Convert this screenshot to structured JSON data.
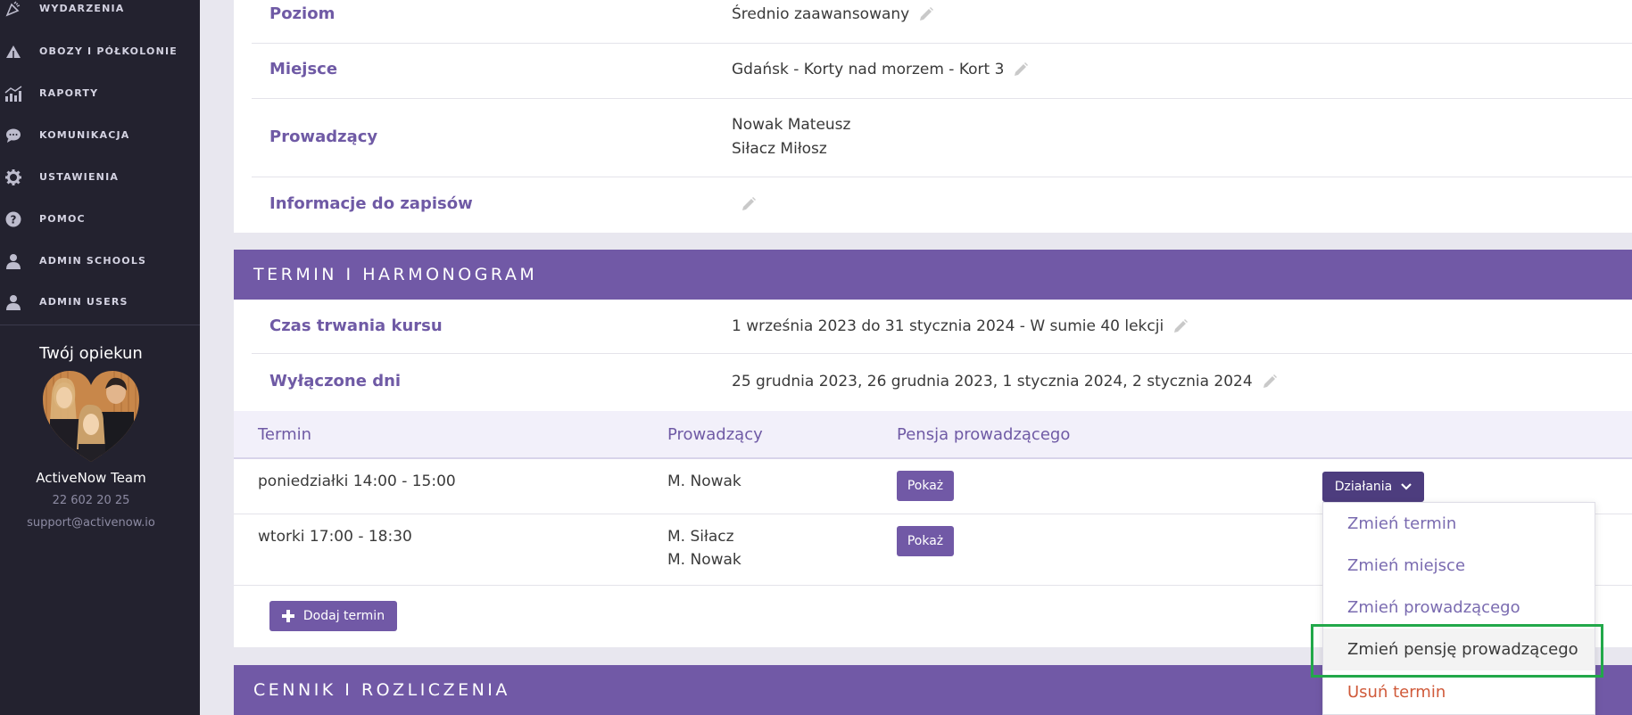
{
  "sidebar": {
    "items": [
      {
        "label": "WYDARZENIA",
        "icon": "party-icon"
      },
      {
        "label": "OBOZY I PÓŁKOLONIE",
        "icon": "tent-icon"
      },
      {
        "label": "RAPORTY",
        "icon": "chart-icon"
      },
      {
        "label": "KOMUNIKACJA",
        "icon": "chat-icon"
      },
      {
        "label": "USTAWIENIA",
        "icon": "gear-icon"
      },
      {
        "label": "POMOC",
        "icon": "help-icon"
      },
      {
        "label": "ADMIN SCHOOLS",
        "icon": "user-icon"
      },
      {
        "label": "ADMIN USERS",
        "icon": "user-icon"
      }
    ],
    "caretaker": {
      "title": "Twój opiekun",
      "name": "ActiveNow Team",
      "phone": "22 602 20 25",
      "email": "support@activenow.io"
    }
  },
  "details": {
    "level": {
      "label": "Poziom",
      "value": "Średnio zaawansowany"
    },
    "place": {
      "label": "Miejsce",
      "value": "Gdańsk - Korty nad morzem - Kort 3"
    },
    "instructors": {
      "label": "Prowadzący",
      "values": [
        "Nowak Mateusz",
        "Siłacz Miłosz"
      ]
    },
    "info": {
      "label": "Informacje do zapisów",
      "value": ""
    }
  },
  "schedule": {
    "title": "TERMIN I HARMONOGRAM",
    "duration": {
      "label": "Czas trwania kursu",
      "value": "1 września 2023 do 31 stycznia 2024 - W sumie 40 lekcji"
    },
    "excluded": {
      "label": "Wyłączone dni",
      "value": "25 grudnia 2023, 26 grudnia 2023, 1 stycznia 2024, 2 stycznia 2024"
    },
    "headers": {
      "term": "Termin",
      "instructor": "Prowadzący",
      "salary": "Pensja prowadzącego"
    },
    "rows": [
      {
        "term": "poniedziałki 14:00 - 15:00",
        "instructors": [
          "M. Nowak"
        ],
        "show_label": "Pokaż"
      },
      {
        "term": "wtorki 17:00 - 18:30",
        "instructors": [
          "M. Siłacz",
          "M. Nowak"
        ],
        "show_label": "Pokaż"
      }
    ],
    "actions_label": "Działania",
    "add_label": "Dodaj termin",
    "dropdown": [
      "Zmień termin",
      "Zmień miejsce",
      "Zmień prowadzącego",
      "Zmień pensję prowadzącego",
      "Usuń termin"
    ]
  },
  "pricing": {
    "title": "CENNIK I ROZLICZENIA"
  },
  "colors": {
    "accent": "#7159a6",
    "sidebar": "#23222f",
    "highlight": "#22a84a",
    "danger": "#d05a3a"
  }
}
